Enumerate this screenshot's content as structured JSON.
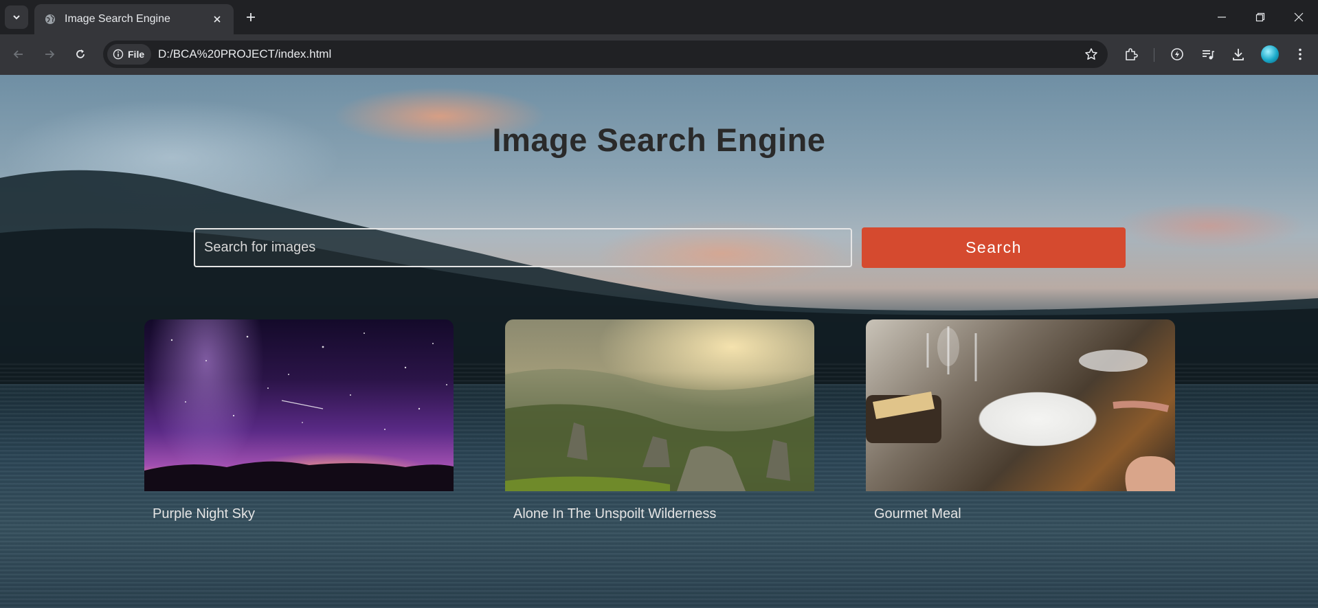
{
  "browser": {
    "tab_title": "Image Search Engine",
    "site_chip": "File",
    "url": "D:/BCA%20PROJECT/index.html"
  },
  "page": {
    "heading": "Image Search Engine",
    "search_placeholder": "Search for images",
    "search_button": "Search",
    "cards": [
      {
        "caption": "Purple Night Sky"
      },
      {
        "caption": "Alone In The Unspoilt Wilderness"
      },
      {
        "caption": "Gourmet Meal"
      }
    ]
  },
  "colors": {
    "accent": "#d54a2f",
    "chrome_dark": "#202124",
    "chrome_toolbar": "#35363a"
  }
}
